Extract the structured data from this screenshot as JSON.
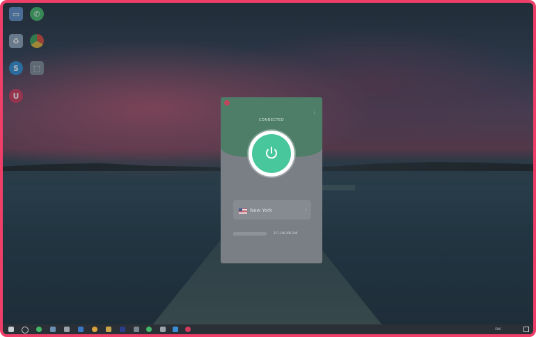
{
  "desktop": {
    "icons": [
      {
        "name": "this-pc",
        "label": "",
        "color": "#5b8fc9"
      },
      {
        "name": "whatsapp",
        "label": "",
        "color": "#43b86a"
      },
      {
        "name": "recycle-bin",
        "label": "",
        "color": "#8aa4b8"
      },
      {
        "name": "google-chrome",
        "label": "",
        "color": "#d8a33a"
      },
      {
        "name": "skype",
        "label": "",
        "color": "#2b8fd6"
      },
      {
        "name": "installer",
        "label": "",
        "color": "#7d8a96"
      },
      {
        "name": "vpn-app",
        "label": "",
        "color": "#d33a5c"
      }
    ]
  },
  "vpn": {
    "status": "CONNECTED",
    "location": {
      "label": "",
      "name": "New York"
    },
    "ip": {
      "value": "217.146.200.106",
      "tag": ""
    },
    "stats": {
      "download": "",
      "upload": "",
      "time": ""
    },
    "colors": {
      "header": "#4e7d68",
      "power": "#48c79c"
    }
  },
  "taskbar": {
    "language": "ENG",
    "time": "",
    "date": ""
  }
}
